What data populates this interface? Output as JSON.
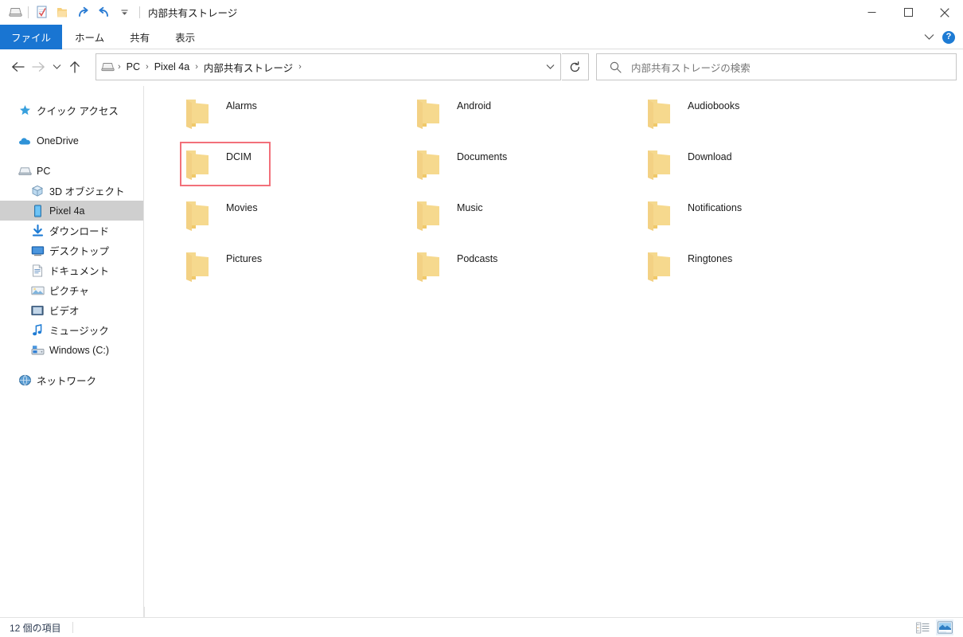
{
  "window": {
    "title": "内部共有ストレージ",
    "quick_access": [
      {
        "name": "device-icon",
        "label": "Pixel 4a"
      },
      {
        "name": "properties-icon",
        "label": "プロパティ"
      },
      {
        "name": "new-folder-icon",
        "label": "新しいフォルダー"
      },
      {
        "name": "redo-icon",
        "label": "やり直し"
      },
      {
        "name": "undo-icon",
        "label": "元に戻す"
      },
      {
        "name": "customize-qat-icon",
        "label": "クイック アクセス ツール バーのユーザー設定"
      }
    ],
    "controls": {
      "minimize": "最小化",
      "maximize": "最大化",
      "close": "閉じる"
    }
  },
  "ribbon": {
    "tabs": [
      {
        "label": "ファイル",
        "active": true
      },
      {
        "label": "ホーム",
        "active": false
      },
      {
        "label": "共有",
        "active": false
      },
      {
        "label": "表示",
        "active": false
      }
    ],
    "expand_label": "リボンの展開",
    "help_label": "?"
  },
  "navigation": {
    "back_label": "戻る",
    "forward_label": "進む",
    "recent_label": "最近表示した場所",
    "up_label": "上へ",
    "refresh_label": "内部共有ストレージの最新の情報に更新",
    "breadcrumb": [
      "PC",
      "Pixel 4a",
      "内部共有ストレージ"
    ],
    "breadcrumb_separator": "›",
    "address_dropdown_label": "以前の場所"
  },
  "search": {
    "placeholder": "内部共有ストレージの検索",
    "icon": "search-icon"
  },
  "sidebar": {
    "items": [
      {
        "label": "クイック アクセス",
        "icon": "star-icon",
        "level": 0,
        "selected": false,
        "gap_after": true
      },
      {
        "label": "OneDrive",
        "icon": "cloud-icon",
        "level": 0,
        "selected": false,
        "gap_after": true
      },
      {
        "label": "PC",
        "icon": "pc-icon",
        "level": 0,
        "selected": false,
        "gap_after": false
      },
      {
        "label": "3D オブジェクト",
        "icon": "3d-objects-icon",
        "level": 1,
        "selected": false,
        "gap_after": false
      },
      {
        "label": "Pixel 4a",
        "icon": "phone-icon",
        "level": 1,
        "selected": true,
        "gap_after": false
      },
      {
        "label": "ダウンロード",
        "icon": "downloads-icon",
        "level": 1,
        "selected": false,
        "gap_after": false
      },
      {
        "label": "デスクトップ",
        "icon": "desktop-icon",
        "level": 1,
        "selected": false,
        "gap_after": false
      },
      {
        "label": "ドキュメント",
        "icon": "documents-icon",
        "level": 1,
        "selected": false,
        "gap_after": false
      },
      {
        "label": "ピクチャ",
        "icon": "pictures-icon",
        "level": 1,
        "selected": false,
        "gap_after": false
      },
      {
        "label": "ビデオ",
        "icon": "videos-icon",
        "level": 1,
        "selected": false,
        "gap_after": false
      },
      {
        "label": "ミュージック",
        "icon": "music-icon",
        "level": 1,
        "selected": false,
        "gap_after": false
      },
      {
        "label": "Windows (C:)",
        "icon": "drive-icon",
        "level": 1,
        "selected": false,
        "gap_after": true
      },
      {
        "label": "ネットワーク",
        "icon": "network-icon",
        "level": 0,
        "selected": false,
        "gap_after": false
      }
    ]
  },
  "files": {
    "items": [
      {
        "name": "Alarms",
        "icon": "folder-icon",
        "highlighted": false
      },
      {
        "name": "Android",
        "icon": "folder-icon",
        "highlighted": false
      },
      {
        "name": "Audiobooks",
        "icon": "folder-icon",
        "highlighted": false
      },
      {
        "name": "DCIM",
        "icon": "folder-icon",
        "highlighted": true
      },
      {
        "name": "Documents",
        "icon": "folder-icon",
        "highlighted": false
      },
      {
        "name": "Download",
        "icon": "folder-icon",
        "highlighted": false
      },
      {
        "name": "Movies",
        "icon": "folder-icon",
        "highlighted": false
      },
      {
        "name": "Music",
        "icon": "folder-icon",
        "highlighted": false
      },
      {
        "name": "Notifications",
        "icon": "folder-icon",
        "highlighted": false
      },
      {
        "name": "Pictures",
        "icon": "folder-icon",
        "highlighted": false
      },
      {
        "name": "Podcasts",
        "icon": "folder-icon",
        "highlighted": false
      },
      {
        "name": "Ringtones",
        "icon": "folder-icon",
        "highlighted": false
      }
    ]
  },
  "status": {
    "item_count": "12 個の項目",
    "views": [
      {
        "name": "details-view-button",
        "label": "詳細表示",
        "active": false
      },
      {
        "name": "large-icons-view-button",
        "label": "大アイコン表示",
        "active": true
      }
    ]
  },
  "colors": {
    "accent": "#1975d2",
    "folder": "#f7d486",
    "highlight_box": "#f2707a",
    "selection": "#cfcfcf"
  }
}
